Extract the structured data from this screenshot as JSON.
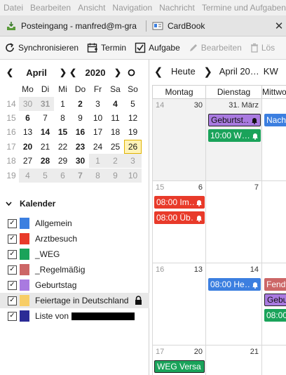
{
  "menu": [
    {
      "label": "Datei"
    },
    {
      "label": "Bearbeiten"
    },
    {
      "label": "Ansicht"
    },
    {
      "label": "Navigation"
    },
    {
      "label": "Nachricht"
    },
    {
      "label": "Termine und Aufgaben"
    }
  ],
  "tabs": [
    {
      "label": "Posteingang - manfred@m-gra",
      "icon": "inbox-icon"
    },
    {
      "label": "CardBook",
      "icon": "cardbook-icon"
    }
  ],
  "toolbar": {
    "sync": "Synchronisieren",
    "event": "Termin",
    "task": "Aufgabe",
    "edit": "Bearbeiten",
    "delete": "Lös"
  },
  "minical": {
    "month": "April",
    "year": "2020",
    "weekdays": [
      "Mo",
      "Di",
      "Mi",
      "Do",
      "Fr",
      "Sa",
      "So"
    ],
    "weeks": [
      {
        "wk": "14",
        "days": [
          {
            "d": "30",
            "o": true
          },
          {
            "d": "31",
            "o": true,
            "b": true
          },
          {
            "d": "1"
          },
          {
            "d": "2",
            "b": true
          },
          {
            "d": "3"
          },
          {
            "d": "4",
            "b": true
          },
          {
            "d": "5"
          }
        ]
      },
      {
        "wk": "15",
        "days": [
          {
            "d": "6",
            "b": true
          },
          {
            "d": "7"
          },
          {
            "d": "8"
          },
          {
            "d": "9"
          },
          {
            "d": "10"
          },
          {
            "d": "11"
          },
          {
            "d": "12"
          }
        ]
      },
      {
        "wk": "16",
        "days": [
          {
            "d": "13"
          },
          {
            "d": "14",
            "b": true
          },
          {
            "d": "15",
            "b": true
          },
          {
            "d": "16",
            "b": true
          },
          {
            "d": "17"
          },
          {
            "d": "18"
          },
          {
            "d": "19"
          }
        ]
      },
      {
        "wk": "17",
        "days": [
          {
            "d": "20",
            "b": true
          },
          {
            "d": "21"
          },
          {
            "d": "22"
          },
          {
            "d": "23",
            "b": true
          },
          {
            "d": "24"
          },
          {
            "d": "25"
          },
          {
            "d": "26",
            "t": true
          }
        ]
      },
      {
        "wk": "18",
        "days": [
          {
            "d": "27"
          },
          {
            "d": "28",
            "b": true
          },
          {
            "d": "29"
          },
          {
            "d": "30",
            "b": true
          },
          {
            "d": "1",
            "o": true
          },
          {
            "d": "2",
            "o": true
          },
          {
            "d": "3",
            "o": true
          }
        ]
      },
      {
        "wk": "19",
        "days": [
          {
            "d": "4",
            "o": true
          },
          {
            "d": "5",
            "o": true
          },
          {
            "d": "6",
            "o": true
          },
          {
            "d": "7",
            "o": true,
            "b": true
          },
          {
            "d": "8",
            "o": true
          },
          {
            "d": "9",
            "o": true
          },
          {
            "d": "10",
            "o": true
          }
        ]
      }
    ]
  },
  "calendars": {
    "header": "Kalender",
    "items": [
      {
        "name": "Allgemein",
        "color": "#3c7fe0",
        "checked": true
      },
      {
        "name": "Arztbesuch",
        "color": "#e83a2a",
        "checked": true
      },
      {
        "name": "_WEG",
        "color": "#1aa35a",
        "checked": true
      },
      {
        "name": "_Regelmäßig",
        "color": "#cc6666",
        "checked": true
      },
      {
        "name": "Geburtstag",
        "color": "#a97ae0",
        "checked": true
      },
      {
        "name": "Feiertage in Deutschland",
        "color": "#f7cd66",
        "checked": true,
        "locked": true,
        "selected": true
      },
      {
        "name": "Liste von",
        "color": "#2b2b96",
        "checked": true,
        "redacted": true
      }
    ]
  },
  "view": {
    "today": "Heute",
    "period": "April 20…",
    "week_label": "KW",
    "day_headers": [
      "Montag",
      "Dienstag",
      "Mittwoch"
    ],
    "weeks": [
      {
        "wk": "14",
        "dates": [
          "30",
          "31. März",
          ""
        ]
      },
      {
        "wk": "15",
        "dates": [
          "6",
          "7",
          ""
        ]
      },
      {
        "wk": "16",
        "dates": [
          "13",
          "14",
          ""
        ]
      },
      {
        "wk": "17",
        "dates": [
          "20",
          "21",
          ""
        ]
      }
    ],
    "events": [
      {
        "label": "Geburtst…",
        "color": "#a97ae0",
        "row": 0,
        "col": 1,
        "slot": 0,
        "bell": true,
        "selected": true
      },
      {
        "label": "10:00 W…",
        "color": "#1aa35a",
        "row": 0,
        "col": 1,
        "slot": 1,
        "bell": true
      },
      {
        "label": "Nacha",
        "color": "#3c7fe0",
        "row": 0,
        "col": 2,
        "slot": 0
      },
      {
        "label": "08:00 Im…",
        "color": "#e83a2a",
        "row": 1,
        "col": 0,
        "slot": 0,
        "bell": true
      },
      {
        "label": "08:00 Üb…",
        "color": "#e83a2a",
        "row": 1,
        "col": 0,
        "slot": 1,
        "bell": true
      },
      {
        "label": "08:00 He…",
        "color": "#3c7fe0",
        "row": 2,
        "col": 1,
        "slot": 0,
        "bell": true
      },
      {
        "label": "Fendt",
        "color": "#cc6666",
        "row": 2,
        "col": 2,
        "slot": 0
      },
      {
        "label": "Gebu",
        "color": "#a97ae0",
        "row": 2,
        "col": 2,
        "slot": 1,
        "selected": true
      },
      {
        "label": "08:00",
        "color": "#1aa35a",
        "row": 2,
        "col": 2,
        "slot": 2
      },
      {
        "label": "WEG Versa…",
        "color": "#1aa35a",
        "row": 3,
        "col": 0,
        "slot": 0,
        "selected": true
      }
    ]
  }
}
